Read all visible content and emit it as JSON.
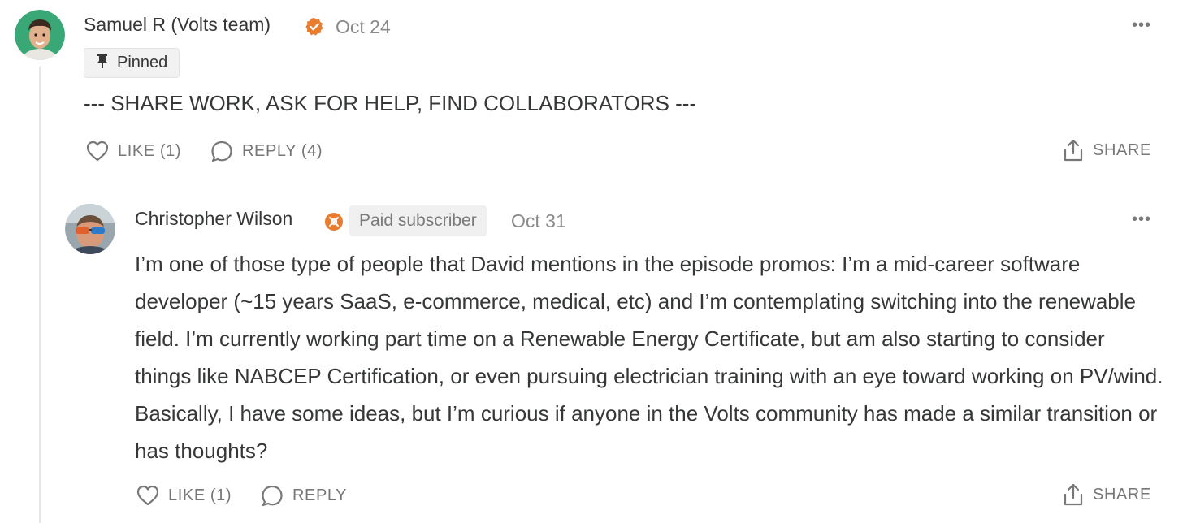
{
  "comment1": {
    "author": "Samuel R (Volts team)",
    "date": "Oct 24",
    "pinned_label": "Pinned",
    "body": "--- SHARE WORK, ASK FOR HELP, FIND COLLABORATORS ---",
    "like_label": "LIKE (1)",
    "reply_label": "REPLY (4)",
    "share_label": "SHARE",
    "more_label": "•••"
  },
  "comment2": {
    "author": "Christopher Wilson",
    "badge": "Paid subscriber",
    "date": "Oct 31",
    "body": "I’m one of those type of people that David mentions in the episode promos: I’m a mid-career software developer (~15 years SaaS, e-commerce, medical, etc) and I’m contemplating switching into the renewable field. I’m currently working part time on a Renewable Energy Certificate, but am also starting to consider things like NABCEP Certification, or even pursuing electrician training with an eye toward working on PV/wind. Basically, I have some ideas, but I’m curious if anyone in the Volts community has made a similar transition or has thoughts?",
    "like_label": "LIKE (1)",
    "reply_label": "REPLY",
    "share_label": "SHARE",
    "more_label": "•••"
  },
  "colors": {
    "accent_orange": "#ea7c2e",
    "text": "#363737",
    "muted": "#8a8a8a",
    "thread_line": "#e6e6e6"
  },
  "icons": [
    "verified-check-icon",
    "pin-icon",
    "heart-icon",
    "comment-bubble-icon",
    "share-upload-icon",
    "subscriber-badge-icon",
    "more-dots-icon"
  ]
}
